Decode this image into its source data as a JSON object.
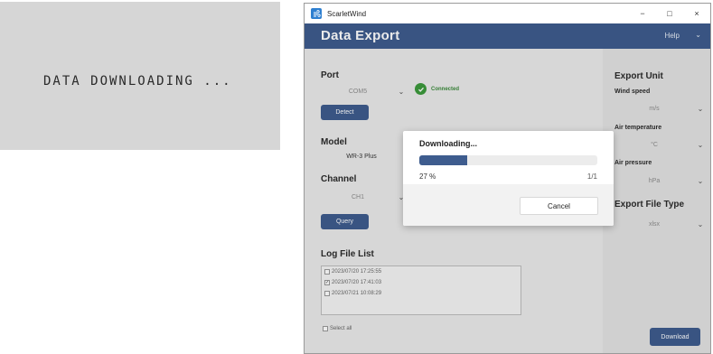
{
  "lcd": {
    "text": "DATA DOWNLOADING ..."
  },
  "window": {
    "app_name": "ScarletWind",
    "controls": {
      "minimize": "−",
      "maximize": "□",
      "close": "×"
    }
  },
  "header": {
    "title": "Data Export",
    "help_label": "Help"
  },
  "port": {
    "label": "Port",
    "value": "COM5",
    "status": "Connected",
    "detect_label": "Detect"
  },
  "model": {
    "label": "Model",
    "value": "WR-3 Plus"
  },
  "channel": {
    "label": "Channel",
    "value": "CH1",
    "query_label": "Query"
  },
  "log": {
    "label": "Log File List",
    "items": [
      {
        "text": "2023/07/20 17:25:55",
        "checked": false
      },
      {
        "text": "2023/07/20 17:41:03",
        "checked": true
      },
      {
        "text": "2023/07/21 10:08:29",
        "checked": false
      }
    ],
    "select_all_label": "Select all"
  },
  "export_unit": {
    "title": "Export Unit",
    "wind_speed_label": "Wind speed",
    "wind_speed_value": "m/s",
    "air_temperature_label": "Air temperature",
    "air_temperature_value": "°C",
    "air_pressure_label": "Air pressure",
    "air_pressure_value": "hPa"
  },
  "export_file_type": {
    "title": "Export File Type",
    "value": "xlsx"
  },
  "download_label": "Download",
  "modal": {
    "title": "Downloading...",
    "progress_percent": 27,
    "percent_text": "27 %",
    "count_text": "1/1",
    "cancel_label": "Cancel"
  },
  "colors": {
    "accent": "#3e5c8e",
    "connected": "#3c9a3c"
  },
  "icons": {
    "app": "wind-app-icon",
    "connected": "check-circle-icon",
    "dropdown": "chevron-down-icon"
  }
}
